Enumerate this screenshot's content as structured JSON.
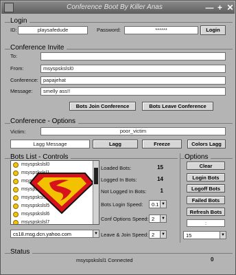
{
  "window": {
    "title": "Conference Boot By Killer Anas",
    "minimize": "—",
    "maximize": "+",
    "close": "✕"
  },
  "login": {
    "title": "Login",
    "id_label": "ID:",
    "id_value": "playsafedude",
    "password_label": "Password:",
    "password_value": "******",
    "login_button": "Login"
  },
  "invite": {
    "title": "Conference Invite",
    "to_label": "To:",
    "to_value": "",
    "from_label": "From:",
    "from_value": "msyspskslsl0",
    "conference_label": "Conference:",
    "conference_value": "papajehat",
    "message_label": "Message:",
    "message_value": "smelly ass!!",
    "join_button": "Bots Join Conference",
    "leave_button": "Bots Leave Conference"
  },
  "options": {
    "title": "Conference - Options",
    "victim_label": "Victim:",
    "victim_value": "poor_victim",
    "lagg_message": "Lagg Message",
    "lagg_button": "Lagg",
    "freeze_button": "Freeze",
    "colors_lagg_button": "Colors Lagg"
  },
  "bots": {
    "title": "Bots List - Controls",
    "list": [
      "msyspskslsl0",
      "msyspskslsl1",
      "msyspskslsl2",
      "msyspskslsl3",
      "msyspskslsl4",
      "msyspskslsl5",
      "msyspskslsl6",
      "msyspskslsl7"
    ],
    "server": "cs18.msg.dcn.yahoo.com",
    "loaded_label": "Loaded Bots:",
    "loaded_value": "15",
    "logged_label": "Logged In Bots:",
    "logged_value": "14",
    "not_logged_label": "Not Logged In Bots:",
    "not_logged_value": "1",
    "login_speed_label": "Bots Login Speed:",
    "login_speed_value": "0.1",
    "conf_speed_label": "Conf Options Speed:",
    "conf_speed_value": "2",
    "leave_join_label": "Leave & Join Speed:",
    "leave_join_value": "2"
  },
  "side_options": {
    "title": "Options",
    "clear": "Clear",
    "login_bots": "Login Bots",
    "logoff_bots": "Logoff Bots",
    "failed_bots": "Failed Bots",
    "refresh_bots": "Refresh Bots",
    "small_field": ":",
    "count_select": "15"
  },
  "status": {
    "title": "Status",
    "message": "msyspskslsl1 Connected",
    "count": "0"
  }
}
